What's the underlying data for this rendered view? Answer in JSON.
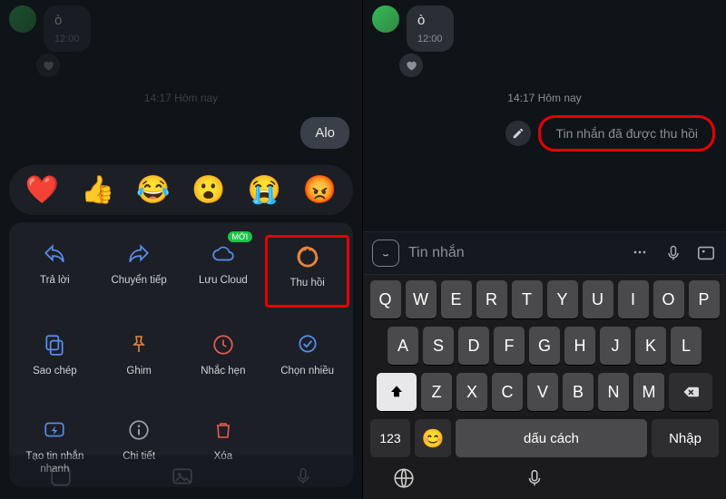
{
  "left": {
    "incoming": {
      "text": "ò",
      "time": "12:00"
    },
    "dateSep": "14:17 Hôm nay",
    "outgoing": "Alo",
    "reactions": [
      "❤️",
      "👍",
      "😂",
      "😮",
      "😭",
      "😡"
    ],
    "actions": {
      "reply": {
        "label": "Trả lời"
      },
      "forward": {
        "label": "Chuyển tiếp"
      },
      "cloud": {
        "label": "Lưu Cloud",
        "badge": "MỚI"
      },
      "recall": {
        "label": "Thu hồi"
      },
      "copy": {
        "label": "Sao chép"
      },
      "pin": {
        "label": "Ghim"
      },
      "remind": {
        "label": "Nhắc hẹn"
      },
      "multisel": {
        "label": "Chọn nhiều"
      },
      "quick": {
        "label": "Tạo tin nhắn nhanh"
      },
      "detail": {
        "label": "Chi tiết"
      },
      "delete": {
        "label": "Xóa"
      }
    },
    "nav": [
      "sticker",
      "image",
      "mic"
    ]
  },
  "right": {
    "incoming": {
      "text": "ò",
      "time": "12:00"
    },
    "dateSep": "14:17 Hôm nay",
    "recalledText": "Tin nhắn đã được thu hồi",
    "inputPlaceholder": "Tin nhắn",
    "keyboard": {
      "row1": [
        "Q",
        "W",
        "E",
        "R",
        "T",
        "Y",
        "U",
        "I",
        "O",
        "P"
      ],
      "row2": [
        "A",
        "S",
        "D",
        "F",
        "G",
        "H",
        "J",
        "K",
        "L"
      ],
      "row3": [
        "Z",
        "X",
        "C",
        "V",
        "B",
        "N",
        "M"
      ],
      "numKey": "123",
      "space": "dấu cách",
      "enter": "Nhập"
    }
  },
  "colors": {
    "iconBlue": "#5b8def",
    "iconOrange": "#e8853e",
    "iconRed": "#e85a55",
    "highlight": "#e80000"
  }
}
